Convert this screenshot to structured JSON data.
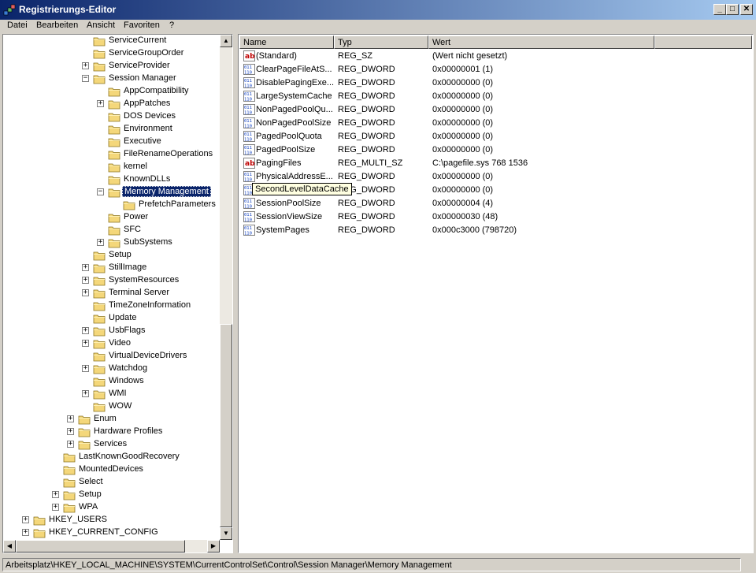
{
  "window": {
    "title": "Registrierungs-Editor"
  },
  "menu": [
    {
      "label": "Datei"
    },
    {
      "label": "Bearbeiten"
    },
    {
      "label": "Ansicht"
    },
    {
      "label": "Favoriten"
    },
    {
      "label": "?"
    }
  ],
  "tree": [
    {
      "label": "ServiceCurrent",
      "level": 5,
      "expander": ""
    },
    {
      "label": "ServiceGroupOrder",
      "level": 5,
      "expander": ""
    },
    {
      "label": "ServiceProvider",
      "level": 5,
      "expander": "+"
    },
    {
      "label": "Session Manager",
      "level": 5,
      "expander": "-"
    },
    {
      "label": "AppCompatibility",
      "level": 6,
      "expander": ""
    },
    {
      "label": "AppPatches",
      "level": 6,
      "expander": "+"
    },
    {
      "label": "DOS Devices",
      "level": 6,
      "expander": ""
    },
    {
      "label": "Environment",
      "level": 6,
      "expander": ""
    },
    {
      "label": "Executive",
      "level": 6,
      "expander": ""
    },
    {
      "label": "FileRenameOperations",
      "level": 6,
      "expander": ""
    },
    {
      "label": "kernel",
      "level": 6,
      "expander": ""
    },
    {
      "label": "KnownDLLs",
      "level": 6,
      "expander": ""
    },
    {
      "label": "Memory Management",
      "level": 6,
      "expander": "-",
      "selected": true
    },
    {
      "label": "PrefetchParameters",
      "level": 7,
      "expander": ""
    },
    {
      "label": "Power",
      "level": 6,
      "expander": ""
    },
    {
      "label": "SFC",
      "level": 6,
      "expander": ""
    },
    {
      "label": "SubSystems",
      "level": 6,
      "expander": "+"
    },
    {
      "label": "Setup",
      "level": 5,
      "expander": ""
    },
    {
      "label": "StillImage",
      "level": 5,
      "expander": "+"
    },
    {
      "label": "SystemResources",
      "level": 5,
      "expander": "+"
    },
    {
      "label": "Terminal Server",
      "level": 5,
      "expander": "+"
    },
    {
      "label": "TimeZoneInformation",
      "level": 5,
      "expander": ""
    },
    {
      "label": "Update",
      "level": 5,
      "expander": ""
    },
    {
      "label": "UsbFlags",
      "level": 5,
      "expander": "+"
    },
    {
      "label": "Video",
      "level": 5,
      "expander": "+"
    },
    {
      "label": "VirtualDeviceDrivers",
      "level": 5,
      "expander": ""
    },
    {
      "label": "Watchdog",
      "level": 5,
      "expander": "+"
    },
    {
      "label": "Windows",
      "level": 5,
      "expander": ""
    },
    {
      "label": "WMI",
      "level": 5,
      "expander": "+"
    },
    {
      "label": "WOW",
      "level": 5,
      "expander": ""
    },
    {
      "label": "Enum",
      "level": 4,
      "expander": "+"
    },
    {
      "label": "Hardware Profiles",
      "level": 4,
      "expander": "+"
    },
    {
      "label": "Services",
      "level": 4,
      "expander": "+"
    },
    {
      "label": "LastKnownGoodRecovery",
      "level": 3,
      "expander": ""
    },
    {
      "label": "MountedDevices",
      "level": 3,
      "expander": ""
    },
    {
      "label": "Select",
      "level": 3,
      "expander": ""
    },
    {
      "label": "Setup",
      "level": 3,
      "expander": "+"
    },
    {
      "label": "WPA",
      "level": 3,
      "expander": "+"
    },
    {
      "label": "HKEY_USERS",
      "level": 1,
      "expander": "+"
    },
    {
      "label": "HKEY_CURRENT_CONFIG",
      "level": 1,
      "expander": "+"
    }
  ],
  "list": {
    "columns": [
      "Name",
      "Typ",
      "Wert"
    ],
    "rows": [
      {
        "name": "(Standard)",
        "type": "REG_SZ",
        "value": "(Wert nicht gesetzt)",
        "icon": "ab"
      },
      {
        "name": "ClearPageFileAtS...",
        "type": "REG_DWORD",
        "value": "0x00000001 (1)",
        "icon": "bin"
      },
      {
        "name": "DisablePagingExe...",
        "type": "REG_DWORD",
        "value": "0x00000000 (0)",
        "icon": "bin"
      },
      {
        "name": "LargeSystemCache",
        "type": "REG_DWORD",
        "value": "0x00000000 (0)",
        "icon": "bin"
      },
      {
        "name": "NonPagedPoolQu...",
        "type": "REG_DWORD",
        "value": "0x00000000 (0)",
        "icon": "bin"
      },
      {
        "name": "NonPagedPoolSize",
        "type": "REG_DWORD",
        "value": "0x00000000 (0)",
        "icon": "bin"
      },
      {
        "name": "PagedPoolQuota",
        "type": "REG_DWORD",
        "value": "0x00000000 (0)",
        "icon": "bin"
      },
      {
        "name": "PagedPoolSize",
        "type": "REG_DWORD",
        "value": "0x00000000 (0)",
        "icon": "bin"
      },
      {
        "name": "PagingFiles",
        "type": "REG_MULTI_SZ",
        "value": "C:\\pagefile.sys 768 1536",
        "icon": "ab"
      },
      {
        "name": "PhysicalAddressE...",
        "type": "REG_DWORD",
        "value": "0x00000000 (0)",
        "icon": "bin"
      },
      {
        "name": "SecondLevelDataCache",
        "type": "REG_DWORD",
        "value": "0x00000000 (0)",
        "icon": "bin"
      },
      {
        "name": "SessionPoolSize",
        "type": "REG_DWORD",
        "value": "0x00000004 (4)",
        "icon": "bin"
      },
      {
        "name": "SessionViewSize",
        "type": "REG_DWORD",
        "value": "0x00000030 (48)",
        "icon": "bin"
      },
      {
        "name": "SystemPages",
        "type": "REG_DWORD",
        "value": "0x000c3000 (798720)",
        "icon": "bin"
      }
    ]
  },
  "tooltip": "SecondLevelDataCache",
  "status": "Arbeitsplatz\\HKEY_LOCAL_MACHINE\\SYSTEM\\CurrentControlSet\\Control\\Session Manager\\Memory Management",
  "colors": {
    "title_start": "#0a246a",
    "title_end": "#a6caf0",
    "selection": "#0a246a",
    "folder": "#f4d77a"
  }
}
